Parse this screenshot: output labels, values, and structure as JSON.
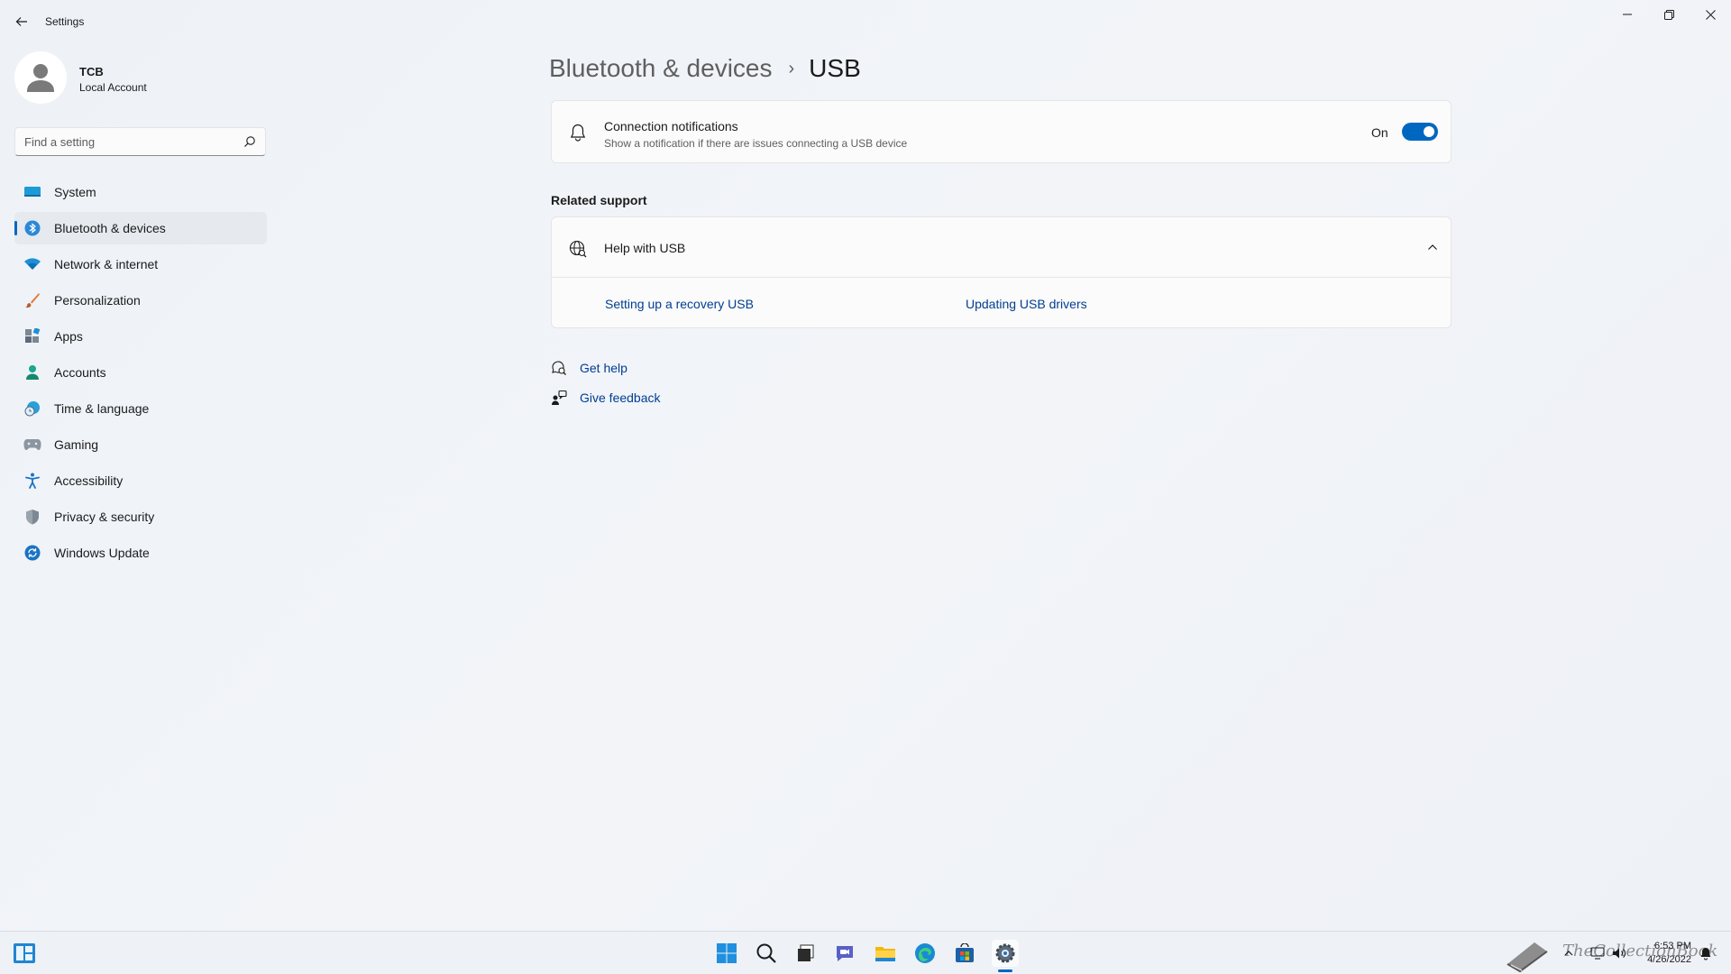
{
  "window": {
    "app_title": "Settings",
    "back_icon": "back-arrow-icon",
    "controls": [
      "minimize-icon",
      "restore-icon",
      "close-icon"
    ]
  },
  "profile": {
    "name": "TCB",
    "account_type": "Local Account"
  },
  "search": {
    "placeholder": "Find a setting"
  },
  "sidebar": {
    "items": [
      {
        "label": "System",
        "icon": "system-icon",
        "active": false
      },
      {
        "label": "Bluetooth & devices",
        "icon": "bluetooth-icon",
        "active": true
      },
      {
        "label": "Network & internet",
        "icon": "wifi-icon",
        "active": false
      },
      {
        "label": "Personalization",
        "icon": "brush-icon",
        "active": false
      },
      {
        "label": "Apps",
        "icon": "apps-icon",
        "active": false
      },
      {
        "label": "Accounts",
        "icon": "account-icon",
        "active": false
      },
      {
        "label": "Time & language",
        "icon": "globe-clock-icon",
        "active": false
      },
      {
        "label": "Gaming",
        "icon": "gamepad-icon",
        "active": false
      },
      {
        "label": "Accessibility",
        "icon": "accessibility-icon",
        "active": false
      },
      {
        "label": "Privacy & security",
        "icon": "shield-icon",
        "active": false
      },
      {
        "label": "Windows Update",
        "icon": "update-icon",
        "active": false
      }
    ]
  },
  "main": {
    "breadcrumb": {
      "parent": "Bluetooth & devices",
      "separator": "›",
      "current": "USB"
    },
    "connection_notifications": {
      "title": "Connection notifications",
      "description": "Show a notification if there are issues connecting a USB device",
      "toggle_state_label": "On",
      "toggle_on": true
    },
    "related_support": {
      "section_title": "Related support",
      "help_title": "Help with USB",
      "expanded": true,
      "links": [
        "Setting up a recovery USB",
        "Updating USB drivers"
      ]
    },
    "footer_links": {
      "get_help": "Get help",
      "give_feedback": "Give feedback"
    }
  },
  "taskbar": {
    "apps": [
      "start-icon",
      "search-icon",
      "task-view-icon",
      "chat-icon",
      "file-explorer-icon",
      "edge-icon",
      "store-icon",
      "settings-icon"
    ],
    "active_app": "settings-icon",
    "clock_time": "6:53 PM",
    "clock_date": "4/26/2022",
    "watermark": "TheCollectionBook"
  },
  "colors": {
    "accent": "#0067c0",
    "link": "#003e92"
  }
}
